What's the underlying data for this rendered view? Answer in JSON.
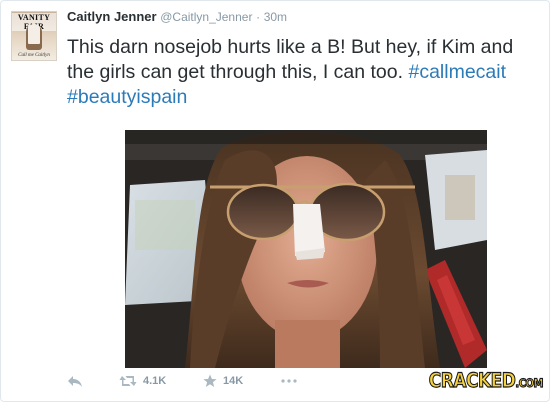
{
  "tweet": {
    "author_name": "Caitlyn Jenner",
    "author_handle": "@Caitlyn_Jenner",
    "separator": "·",
    "timestamp": "30m",
    "text_plain": "This darn nosejob hurts like a B! But hey, if Kim and the girls can get through this, I can too.",
    "hashtags": [
      "#callmecait",
      "#beautyispain"
    ]
  },
  "avatar": {
    "masthead": "VANITY FAIR",
    "cover_line": "Call me Caitlyn"
  },
  "actions": {
    "reply_icon": "reply-icon",
    "retweet_icon": "retweet-icon",
    "retweet_count": "4.1K",
    "favorite_icon": "star-icon",
    "favorite_count": "14K",
    "more_icon": "more-icon"
  },
  "watermark": {
    "text": "CRACKED",
    "suffix": ".COM"
  },
  "colors": {
    "hashtag": "#2b7bb9",
    "muted": "#8899a6",
    "text": "#292f33",
    "watermark": "#f7d23c"
  }
}
